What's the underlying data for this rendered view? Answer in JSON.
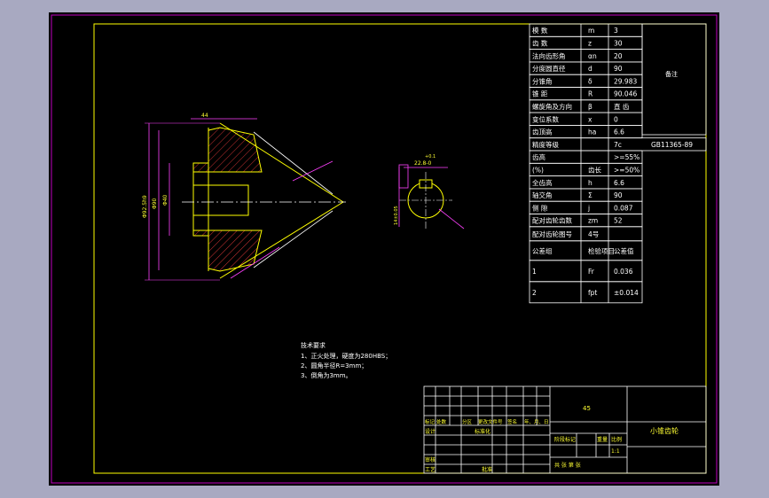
{
  "colors": {
    "background": "#a8a9c1",
    "paper": "#000000",
    "frame": "#c000c0",
    "border": "#ffff00",
    "table": "#ffffff",
    "outline": "#ffff00",
    "hatch": "#ff4040",
    "dims": "#ff40ff",
    "center": "#ffffff"
  },
  "params": [
    {
      "name": "模  数",
      "sym": "m",
      "val": "3"
    },
    {
      "name": "齿  数",
      "sym": "z",
      "val": "30"
    },
    {
      "name": "法向齿形角",
      "sym": "αn",
      "val": "20"
    },
    {
      "name": "分度圆直径",
      "sym": "d",
      "val": "90"
    },
    {
      "name": "分锥角",
      "sym": "δ",
      "val": "29.983"
    },
    {
      "name": "锥  距",
      "sym": "R",
      "val": "90.046"
    },
    {
      "name": "螺旋角及方向",
      "sym": "β",
      "val": "直 齿"
    },
    {
      "name": "变位系数",
      "sym": "x",
      "val": "0"
    },
    {
      "name": "齿顶高",
      "sym": "ha",
      "val": "6.6"
    },
    {
      "name": "精度等级",
      "sym": "",
      "val": "7c",
      "extra": "GB11365-89"
    },
    {
      "name": "齿高",
      "sym": "",
      "val": ">=55%"
    },
    {
      "name": "(%)",
      "sym": "齿长",
      "val": ">=50%"
    },
    {
      "name": "全齿高",
      "sym": "h",
      "val": "6.6"
    },
    {
      "name": "轴交角",
      "sym": "Σ",
      "val": "90"
    },
    {
      "name": "侧  隙",
      "sym": "j",
      "val": "0.087"
    },
    {
      "name": "配对齿轮齿数",
      "sym": "zm",
      "val": "52"
    },
    {
      "name": "配对齿轮图号",
      "sym": "4号",
      "val": ""
    },
    {
      "name": "公差组",
      "sym": "检验项目",
      "val": "公差值"
    },
    {
      "name": "1",
      "sym": "Fr",
      "val": "0.036"
    },
    {
      "name": "2",
      "sym": "fpt",
      "val": "±0.014"
    }
  ],
  "side_note": "备注",
  "notes": {
    "title": "技术要求",
    "items": [
      "1、正火处理，硬度为280HBS；",
      "2、圆角半径R=3mm；",
      "3、倒角为3mm。"
    ]
  },
  "title_block": {
    "material": "45",
    "part_name": "小锥齿轮",
    "mark_label": "阶段标记",
    "weight_label": "重量",
    "scale_label": "比例",
    "scale": "1:1",
    "row_labels": [
      "标记",
      "处数",
      "分区",
      "更改文件号",
      "签名",
      "年、月、日"
    ],
    "design": "设计",
    "standard": "标准化",
    "review": "审核",
    "process": "工艺",
    "approve": "批准",
    "sheet": "共  张  第  张"
  },
  "dims": {
    "d1": "Φ92.5h9",
    "d2": "Φ90",
    "d3": "Φ40",
    "l1": "44",
    "key": "22.8-0",
    "tol": "+0.1",
    "key2": "14±0.05"
  }
}
